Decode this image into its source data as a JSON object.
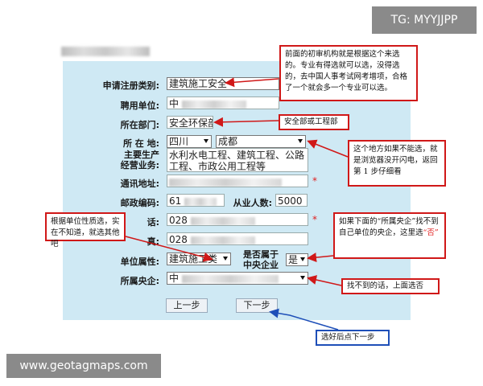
{
  "watermark_top": "TG: MYYJJPP",
  "watermark_bottom": "www.geotagmaps.com",
  "form": {
    "reg_type_label": "申请注册类别:",
    "reg_type_value": "建筑施工安全",
    "employer_label": "聘用单位:",
    "employer_value": "中",
    "dept_label": "所在部门:",
    "dept_value": "安全环保部",
    "location_label": "所 在 地:",
    "province_value": "四川",
    "city_value": "成都",
    "business_label_1": "主要生产",
    "business_label_2": "经营业务:",
    "business_value": "水利水电工程、建筑工程、公路工程、市政公用工程等",
    "address_label": "通讯地址:",
    "address_value": "",
    "postcode_label": "邮政编码:",
    "postcode_value": "61",
    "staff_label": "从业人数:",
    "staff_value": "5000",
    "phone_label": "话:",
    "phone_value": "028",
    "fax_label": "真:",
    "fax_value": "028",
    "unit_nature_label": "单位属性:",
    "unit_nature_value": "建筑施工类",
    "central_q_label_1": "是否属于",
    "central_q_label_2": "中央企业",
    "central_q_value": "是",
    "central_sel_label": "所属央企:",
    "central_sel_value": "中",
    "prev_button": "上一步",
    "next_button": "下一步",
    "required_mark": "*"
  },
  "notes": {
    "initial_review": "前面的初审机构就是根据这个来选的。专业有得选就可以选，没得选的，去中国人事考试网考增项，合格了一个就会多一个专业可以选。",
    "dept": "安全部或工程部",
    "location": "这个地方如果不能选，就是浏览器没开闪电，返回第 1 步仔细看",
    "unit_nature": "根据单位性质选，实在不知道，就选其他吧",
    "central_1": "如果下面的“所属央企”找不到自己单位的央企，这里选",
    "central_2": "“否”",
    "not_found": "找不到的话，上面选否",
    "next": "选好后点下一步"
  },
  "colors": {
    "form_bg": "#cfe9f4",
    "note_border_red": "#d01818",
    "note_border_blue": "#1e4fb8",
    "required": "#e02020"
  }
}
